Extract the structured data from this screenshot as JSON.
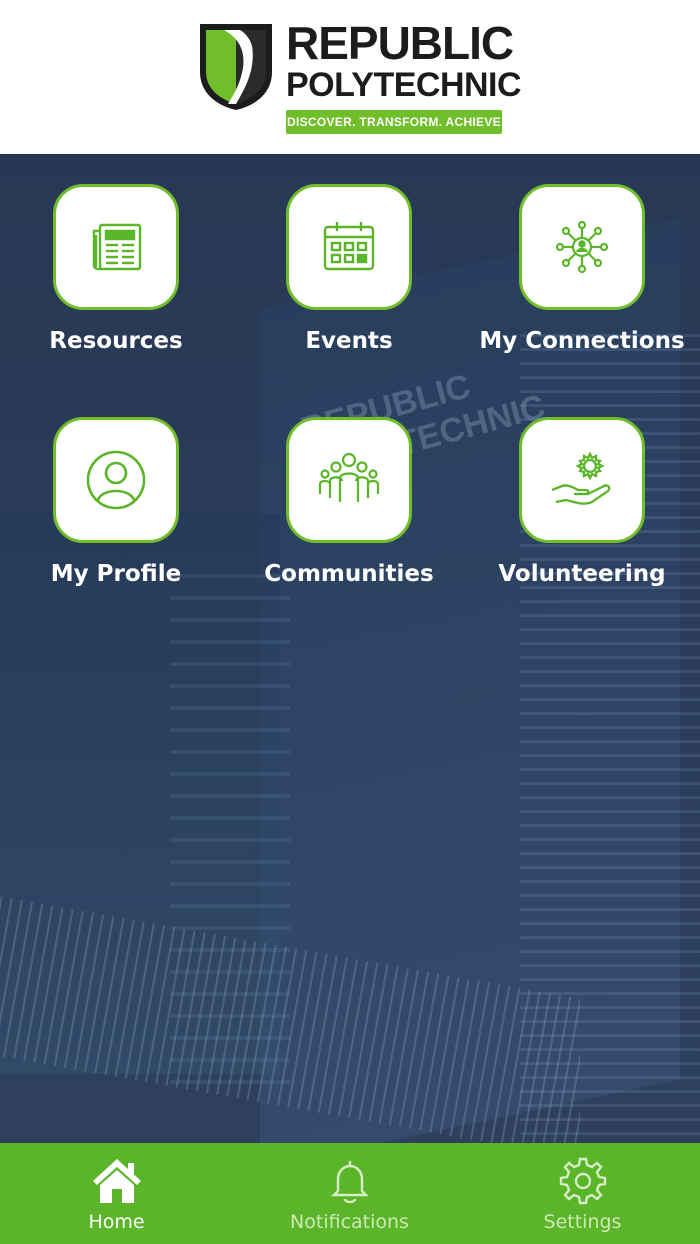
{
  "header": {
    "brand_line1": "REPUBLIC",
    "brand_line2": "POLYTECHNIC",
    "tagline": "DISCOVER. TRANSFORM. ACHIEVE"
  },
  "background_watermark": "REPUBLIC POLYTECHNIC",
  "tiles": [
    {
      "label": "Resources",
      "icon": "newspaper-icon"
    },
    {
      "label": "Events",
      "icon": "calendar-icon"
    },
    {
      "label": "My Connections",
      "icon": "network-icon"
    },
    {
      "label": "My Profile",
      "icon": "user-circle-icon"
    },
    {
      "label": "Communities",
      "icon": "group-icon"
    },
    {
      "label": "Volunteering",
      "icon": "hand-gear-icon"
    }
  ],
  "bottom_nav": [
    {
      "label": "Home",
      "icon": "home-icon",
      "active": true
    },
    {
      "label": "Notifications",
      "icon": "bell-icon",
      "active": false
    },
    {
      "label": "Settings",
      "icon": "gear-icon",
      "active": false
    }
  ],
  "colors": {
    "accent_green": "#6fbe2a",
    "nav_green": "#5ab528",
    "overlay_navy": "#1c2f4e"
  }
}
